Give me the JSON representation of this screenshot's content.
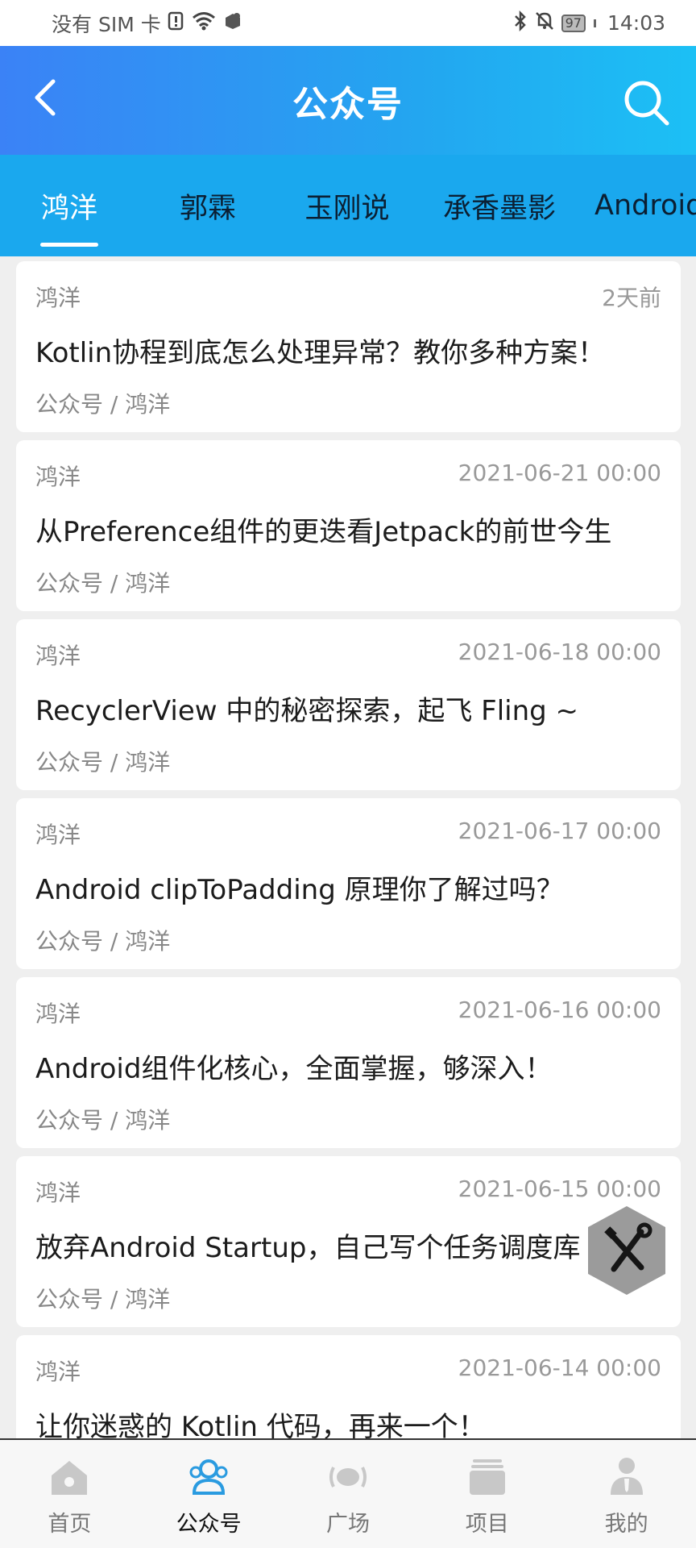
{
  "status_bar": {
    "carrier": "没有 SIM 卡",
    "battery": "97",
    "time": "14:03"
  },
  "header": {
    "title": "公众号",
    "back_icon": "chevron-left-icon",
    "search_icon": "search-icon"
  },
  "tabs": [
    {
      "label": "鸿洋",
      "active": true
    },
    {
      "label": "郭霖",
      "active": false
    },
    {
      "label": "玉刚说",
      "active": false
    },
    {
      "label": "承香墨影",
      "active": false
    },
    {
      "label": "Android",
      "active": false
    }
  ],
  "articles": [
    {
      "author": "鸿洋",
      "date": "2天前",
      "title": "Kotlin协程到底怎么处理异常？教你多种方案！",
      "category": "公众号 / 鸿洋"
    },
    {
      "author": "鸿洋",
      "date": "2021-06-21 00:00",
      "title": "从Preference组件的更迭看Jetpack的前世今生",
      "category": "公众号 / 鸿洋"
    },
    {
      "author": "鸿洋",
      "date": "2021-06-18 00:00",
      "title": "RecyclerView 中的秘密探索，起飞 Fling ~",
      "category": "公众号 / 鸿洋"
    },
    {
      "author": "鸿洋",
      "date": "2021-06-17 00:00",
      "title": "Android clipToPadding 原理你了解过吗？",
      "category": "公众号 / 鸿洋"
    },
    {
      "author": "鸿洋",
      "date": "2021-06-16 00:00",
      "title": "Android组件化核心，全面掌握，够深入！",
      "category": "公众号 / 鸿洋"
    },
    {
      "author": "鸿洋",
      "date": "2021-06-15 00:00",
      "title": "放弃Android Startup，自己写个任务调度库",
      "category": "公众号 / 鸿洋"
    },
    {
      "author": "鸿洋",
      "date": "2021-06-14 00:00",
      "title": "让你迷惑的 Kotlin 代码，再来一个！",
      "category": ""
    }
  ],
  "fab": {
    "icon": "tools-icon"
  },
  "bottom_nav": [
    {
      "label": "首页",
      "icon": "home-icon",
      "active": false
    },
    {
      "label": "公众号",
      "icon": "people-icon",
      "active": true
    },
    {
      "label": "广场",
      "icon": "broadcast-icon",
      "active": false
    },
    {
      "label": "项目",
      "icon": "folder-icon",
      "active": false
    },
    {
      "label": "我的",
      "icon": "user-icon",
      "active": false
    }
  ],
  "colors": {
    "header_start": "#3b82f6",
    "header_end": "#1cc0f5",
    "tab_bar": "#1aa8ee",
    "nav_active": "#2a9be0",
    "nav_inactive": "#c4c4c4"
  }
}
